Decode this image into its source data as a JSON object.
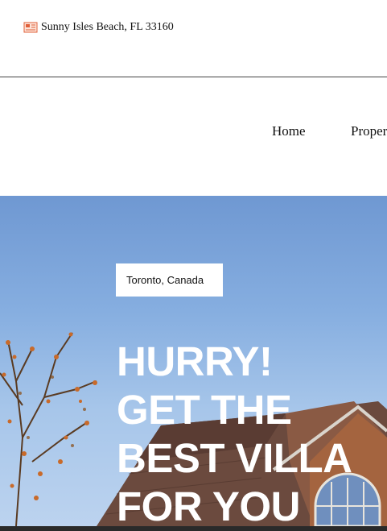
{
  "topbar": {
    "address_icon": "map-card-icon",
    "address": "Sunny Isles Beach, FL 33160"
  },
  "nav": {
    "items": [
      {
        "label": "Home"
      },
      {
        "label": "Proper"
      }
    ]
  },
  "hero": {
    "location": "Toronto, Canada",
    "headline_lines": [
      "HURRY!",
      "GET THE",
      "BEST VILLA",
      "FOR YOU"
    ]
  },
  "colors": {
    "sky": "#7aa3da",
    "headline": "#ffffff",
    "icon": "#e0603a"
  }
}
